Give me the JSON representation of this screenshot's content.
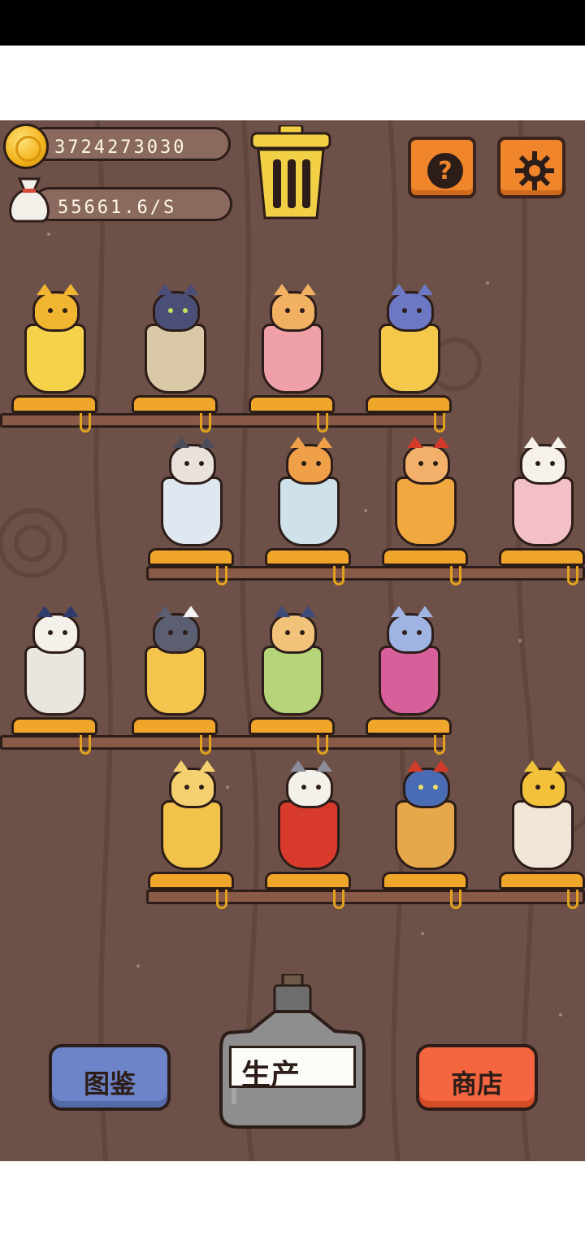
{
  "hud": {
    "coins": "3724273030",
    "income_rate": "55661.6/S",
    "coin_icon": "coin-icon",
    "bag_icon": "money-bag-icon",
    "trash_icon": "trash-can-icon",
    "help_icon": "question-icon",
    "settings_icon": "gear-icon"
  },
  "shelves": [
    {
      "row": 1,
      "cats": [
        "king-cat-in-red-robe",
        "black-cat-in-grapes-glass",
        "orange-cat-in-pink-drink",
        "witch-cat-in-beer-mug"
      ]
    },
    {
      "row": 2,
      "cats": [
        "cat-in-plaid-cap",
        "tabby-cat-in-teacup",
        "cat-with-red-hat-in-tea-glass",
        "white-cat-in-rose-sundae"
      ]
    },
    {
      "row": 3,
      "cats": [
        "qing-official-cat-in-bowl",
        "two-cats-in-beer-mug",
        "sunflower-cat-in-green-drink",
        "blue-cat-in-wine-glass"
      ]
    },
    {
      "row": 4,
      "cats": [
        "yellow-cat-with-sunglasses",
        "calico-cat-in-red-jacket",
        "cat-in-red-hood-in-mug",
        "golden-armor-cat-in-cup"
      ]
    }
  ],
  "buttons": {
    "collection": "图鉴",
    "produce": "生产",
    "shop": "商店"
  },
  "colors": {
    "wood_background": "#6d5148",
    "shelf_base": "#f0a62a",
    "orange_button": "#f1852b",
    "collection_button": "#6d85c8",
    "shop_button": "#f4663f",
    "bottle_gray": "#8f8e8e"
  }
}
